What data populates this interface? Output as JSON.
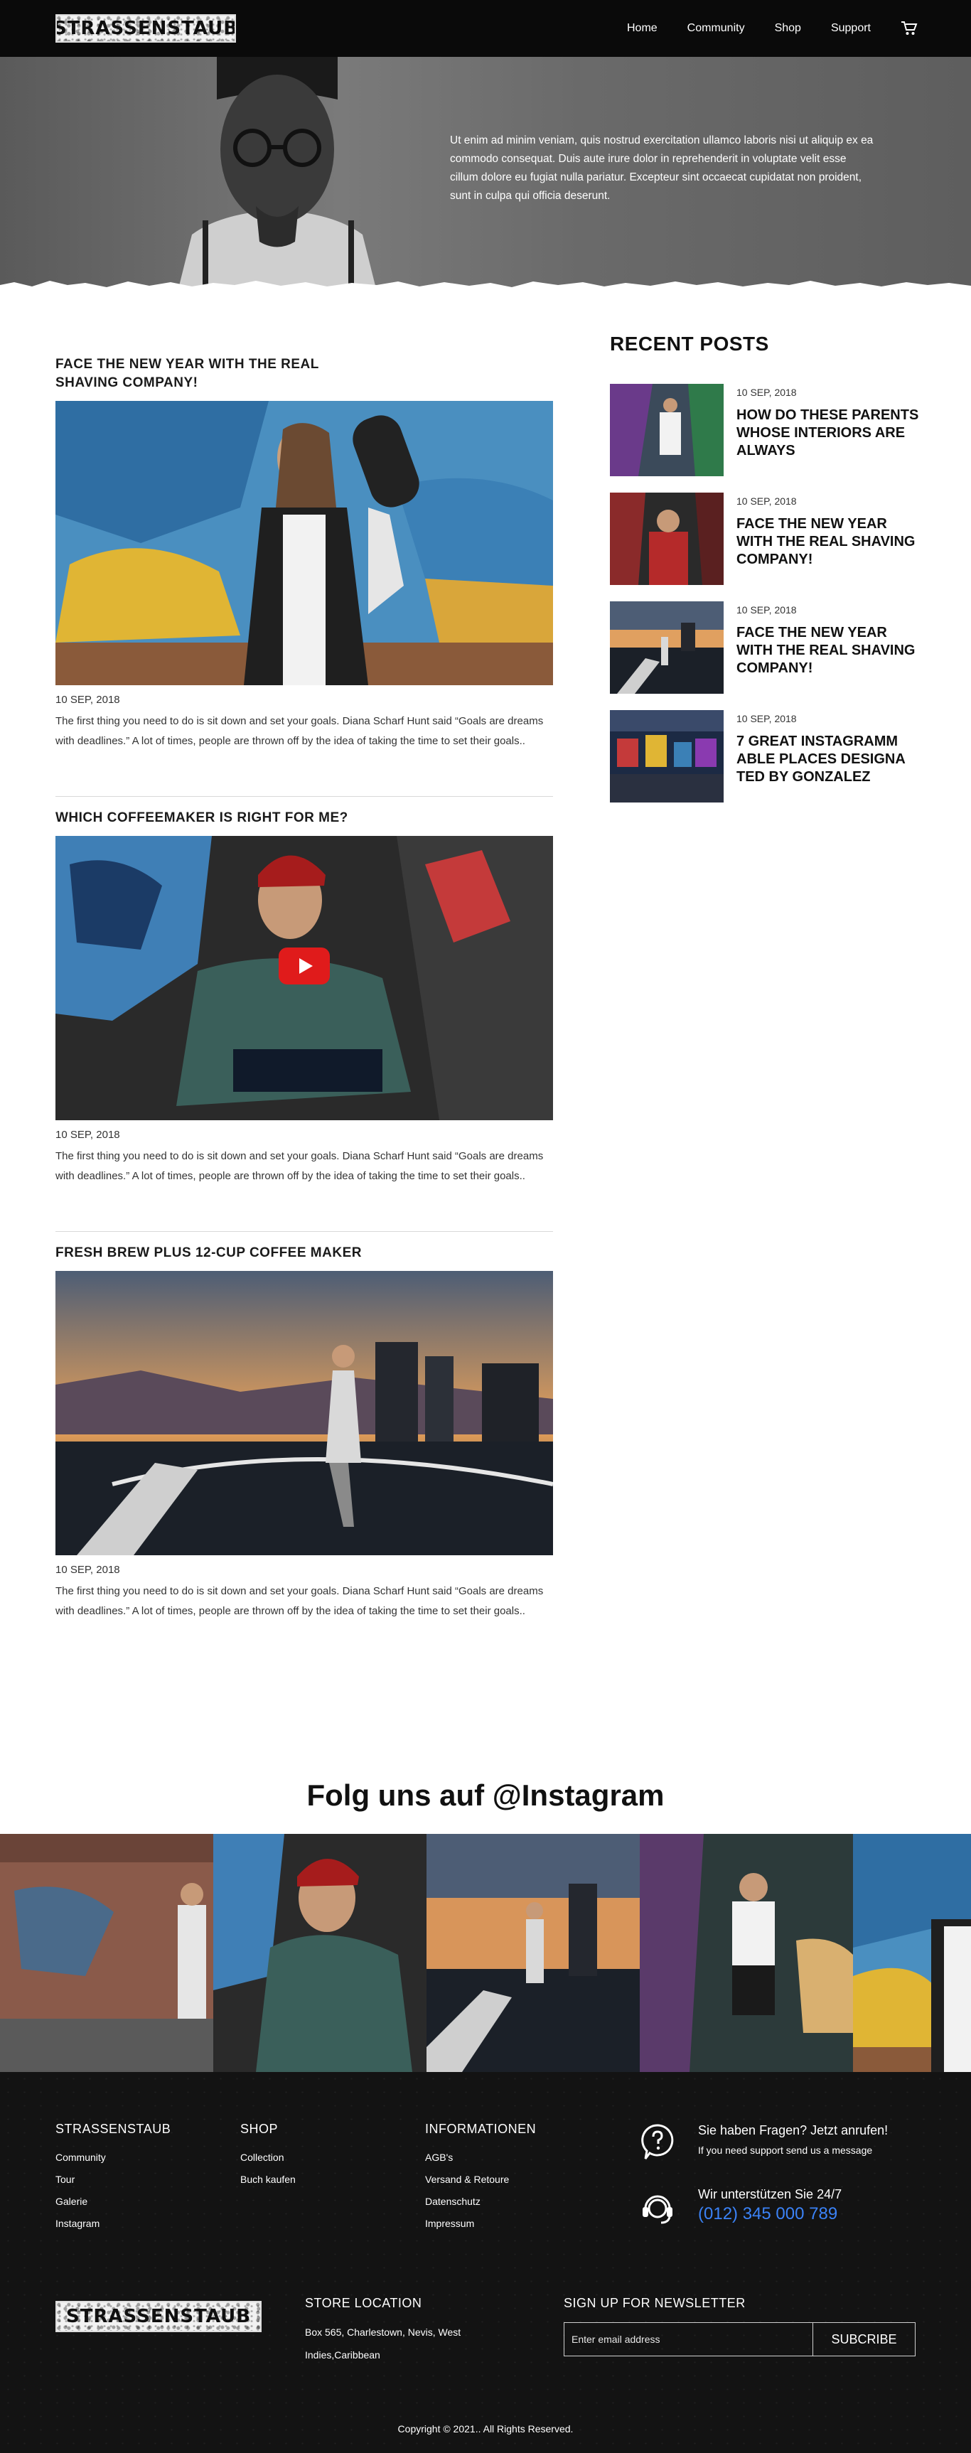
{
  "nav": {
    "logo_text": "STRASSENSTAUB",
    "items": [
      {
        "label": "Home"
      },
      {
        "label": "Community"
      },
      {
        "label": "Shop"
      },
      {
        "label": "Support"
      }
    ],
    "cart_icon": "cart-icon"
  },
  "hero": {
    "text": "Ut enim ad minim veniam, quis nostrud exercitation ullamco laboris nisi ut aliquip ex ea commodo consequat. Duis aute irure dolor in reprehenderit in voluptate velit esse cillum dolore eu fugiat nulla pariatur. Excepteur sint occaecat cupidatat non proident, sunt in culpa qui officia deserunt."
  },
  "posts": [
    {
      "title": "FACE THE NEW YEAR WITH THE REAL SHAVING COMPANY!",
      "date": "10 SEP, 2018",
      "excerpt": "The first thing you need to do is sit down and set your goals. Diana Scharf Hunt said “Goals are dreams with deadlines.” A lot of times, people are thrown off by the idea of taking the time to set their goals.."
    },
    {
      "title": "WHICH COFFEEMAKER IS RIGHT FOR ME?",
      "date": "10 SEP, 2018",
      "excerpt": "The first thing you need to do is sit down and set your goals. Diana Scharf Hunt said “Goals are dreams with deadlines.” A lot of times, people are thrown off by the idea of taking the time to set their goals.."
    },
    {
      "title": "FRESH BREW PLUS 12-CUP COFFEE MAKER",
      "date": "10 SEP, 2018",
      "excerpt": "The first thing you need to do is sit down and set your goals. Diana Scharf Hunt said “Goals are dreams with deadlines.” A lot of times, people are thrown off by the idea of taking the time to set their goals.."
    }
  ],
  "recent": {
    "heading": "RECENT POSTS",
    "items": [
      {
        "date": "10 SEP, 2018",
        "title": "HOW DO THESE PARENTS WHOSE INTERIORS ARE ALWAYS"
      },
      {
        "date": "10 SEP, 2018",
        "title": "FACE THE NEW YEAR WITH THE REAL SHAVING COMPANY!"
      },
      {
        "date": "10 SEP, 2018",
        "title": "FACE THE NEW YEAR WITH THE REAL SHAVING COMPANY!"
      },
      {
        "date": "10 SEP, 2018",
        "title": "7 GREAT INSTAGRAMM ABLE PLACES DESIGNA TED BY GONZALEZ"
      }
    ]
  },
  "instagram": {
    "heading": "Folg uns auf @Instagram"
  },
  "footer": {
    "col1": {
      "heading": "STRASSENSTAUB",
      "links": [
        "Community",
        "Tour",
        "Galerie",
        "Instagram"
      ]
    },
    "col2": {
      "heading": "SHOP",
      "links": [
        "Collection",
        "Buch kaufen"
      ]
    },
    "col3": {
      "heading": "INFORMATIONEN",
      "links": [
        "AGB's",
        "Versand & Retoure",
        "Datenschutz",
        "Impressum"
      ]
    },
    "contact": {
      "call_title": "Sie haben Fragen? Jetzt anrufen!",
      "call_sub": "If you need support send us a message",
      "support_title": "Wir unterstützen Sie 24/7",
      "phone": "(012) 345 000 789",
      "link_color": "#3b82f6"
    },
    "logo_text": "STRASSENSTAUB",
    "store": {
      "heading": "STORE LOCATION",
      "address": "Box 565, Charlestown, Nevis, West Indies,Caribbean"
    },
    "newsletter": {
      "heading": "SIGN UP FOR NEWSLETTER",
      "placeholder": "Enter email address",
      "button": "SUBCRIBE"
    },
    "copyright": "Copyright © 2021.. All Rights Reserved."
  }
}
